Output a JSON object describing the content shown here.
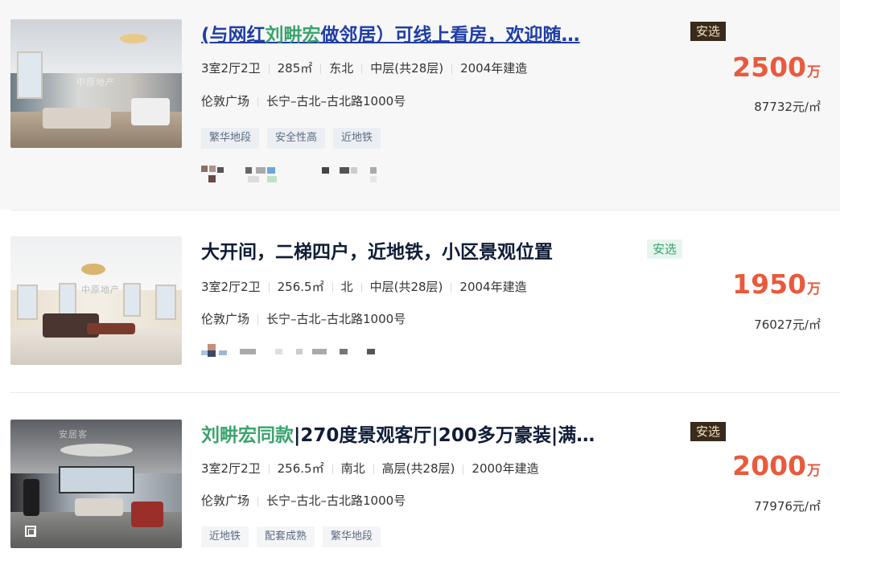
{
  "listings": [
    {
      "title_prefix": "(与网红",
      "title_highlight": "刘畊宏",
      "title_suffix": "做邻居）可线上看房，欢迎随…",
      "badge": "安选",
      "layout": "3室2厅2卫",
      "area": "285㎡",
      "orientation": "东北",
      "floor": "中层(共28层)",
      "built": "2004年建造",
      "community": "伦敦广场",
      "location": "长宁–古北–古北路1000号",
      "tags": [
        "繁华地段",
        "安全性高",
        "近地铁"
      ],
      "price_num": "2500",
      "price_unit": "万",
      "unit_price": "87732元/㎡"
    },
    {
      "title": "大开间，二梯四户，近地铁，小区景观位置",
      "badge": "安选",
      "layout": "3室2厅2卫",
      "area": "256.5㎡",
      "orientation": "北",
      "floor": "中层(共28层)",
      "built": "2004年建造",
      "community": "伦敦广场",
      "location": "长宁–古北–古北路1000号",
      "price_num": "1950",
      "price_unit": "万",
      "unit_price": "76027元/㎡"
    },
    {
      "title_highlight": "刘畊宏同款",
      "title_suffix": "|270度景观客厅|200多万豪装|满…",
      "badge": "安选",
      "layout": "3室2厅2卫",
      "area": "256.5㎡",
      "orientation": "南北",
      "floor": "高层(共28层)",
      "built": "2000年建造",
      "community": "伦敦广场",
      "location": "长宁–古北–古北路1000号",
      "tags": [
        "近地铁",
        "配套成熟",
        "繁华地段"
      ],
      "price_num": "2000",
      "price_unit": "万",
      "unit_price": "77976元/㎡"
    }
  ],
  "colors": {
    "price": "#e95a3c",
    "highlight": "#3aa36e",
    "link": "#1f3ea6",
    "badge_dark": "#3a2a1c",
    "badge_light": "#e7f5ee"
  },
  "icons": [
    "panorama-icon"
  ]
}
